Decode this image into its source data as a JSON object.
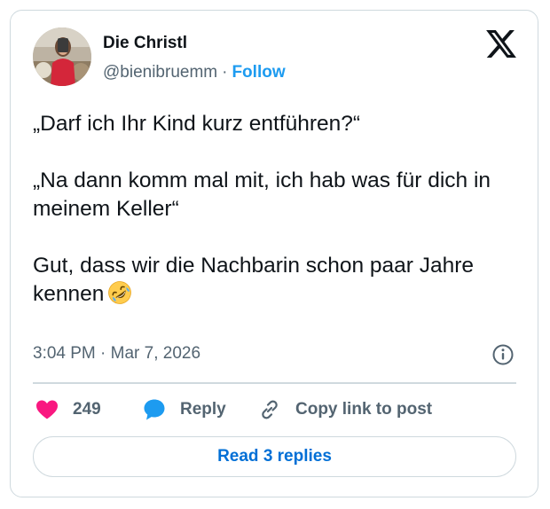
{
  "author": {
    "name": "Die Christl",
    "handle": "@bienibruemm",
    "separator": "·",
    "follow_label": "Follow"
  },
  "tweet": {
    "paragraphs": [
      "„Darf ich Ihr Kind kurz entführen?“",
      "„Na dann komm mal mit, ich hab was für dich in meinem Keller“",
      "Gut, dass wir die Nachbarin schon paar Jahre kennen"
    ],
    "emoji": "rolling-on-the-floor-laughing",
    "timestamp": "3:04 PM · Mar 7, 2026"
  },
  "actions": {
    "like_count": "249",
    "reply_label": "Reply",
    "copy_label": "Copy link to post"
  },
  "read_replies_label": "Read 3 replies",
  "icons": {
    "logo": "x-logo-icon",
    "info": "info-icon",
    "like": "heart-icon",
    "reply": "speech-bubble-icon",
    "copy": "link-icon"
  },
  "colors": {
    "accent": "#1d9bf0",
    "heart": "#f91880",
    "text": "#0f1419",
    "muted": "#536471",
    "border": "#cfd9de"
  }
}
